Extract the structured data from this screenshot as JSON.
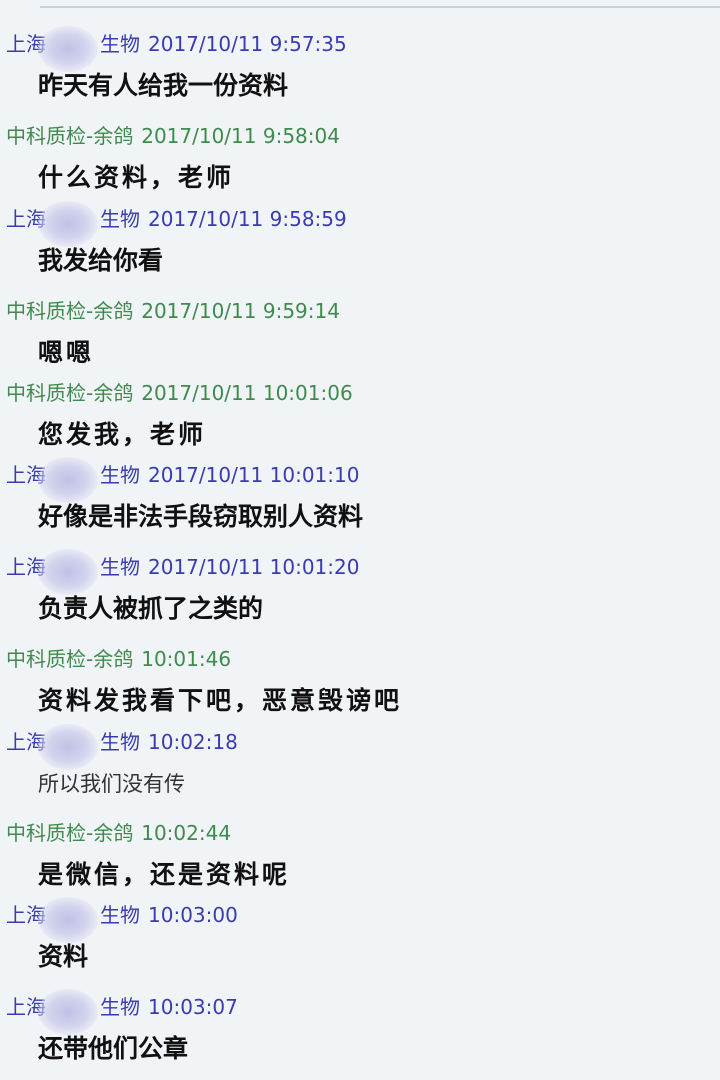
{
  "messages": [
    {
      "sender_prefix": "上海",
      "sender_suffix": "生物",
      "color": "blue",
      "time": "2017/10/11 9:57:35",
      "text": "昨天有人给我一份资料",
      "style": "bold"
    },
    {
      "sender_prefix": "中科质检-余鸽",
      "sender_suffix": "",
      "color": "green",
      "time": "2017/10/11 9:58:04",
      "text": "什么资料，老师",
      "style": "serif"
    },
    {
      "sender_prefix": "上海",
      "sender_suffix": "生物",
      "color": "blue",
      "time": "2017/10/11 9:58:59",
      "text": "我发给你看",
      "style": "bold"
    },
    {
      "sender_prefix": "中科质检-余鸽",
      "sender_suffix": "",
      "color": "green",
      "time": "2017/10/11 9:59:14",
      "text": "嗯嗯",
      "style": "serif"
    },
    {
      "sender_prefix": "中科质检-余鸽",
      "sender_suffix": "",
      "color": "green",
      "time": "2017/10/11 10:01:06",
      "text": "您发我，老师",
      "style": "serif"
    },
    {
      "sender_prefix": "上海",
      "sender_suffix": "生物",
      "color": "blue",
      "time": "2017/10/11 10:01:10",
      "text": "好像是非法手段窃取别人资料",
      "style": "bold"
    },
    {
      "sender_prefix": "上海",
      "sender_suffix": "生物",
      "color": "blue",
      "time": "2017/10/11 10:01:20",
      "text": "负责人被抓了之类的",
      "style": "bold"
    },
    {
      "sender_prefix": "中科质检-余鸽",
      "sender_suffix": "",
      "color": "green",
      "time": "10:01:46",
      "text": "资料发我看下吧，恶意毁谤吧",
      "style": "serif"
    },
    {
      "sender_prefix": "上海",
      "sender_suffix": "生物",
      "color": "blue",
      "time": "10:02:18",
      "text": "所以我们没有传",
      "style": "plain"
    },
    {
      "sender_prefix": "中科质检-余鸽",
      "sender_suffix": "",
      "color": "green",
      "time": "10:02:44",
      "text": "是微信，还是资料呢",
      "style": "serif"
    },
    {
      "sender_prefix": "上海",
      "sender_suffix": "生物",
      "color": "blue",
      "time": "10:03:00",
      "text": "资料",
      "style": "bold"
    },
    {
      "sender_prefix": "上海",
      "sender_suffix": "生物",
      "color": "blue",
      "time": "10:03:07",
      "text": "还带他们公章",
      "style": "bold"
    }
  ]
}
